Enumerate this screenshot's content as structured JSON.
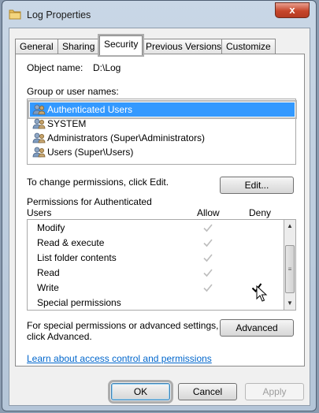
{
  "window": {
    "title": "Log Properties",
    "close_label": "x"
  },
  "tabs": [
    {
      "label": "General"
    },
    {
      "label": "Sharing"
    },
    {
      "label": "Security"
    },
    {
      "label": "Previous Versions"
    },
    {
      "label": "Customize"
    }
  ],
  "security": {
    "object_name_label": "Object name:",
    "object_name_value": "D:\\Log",
    "groups_label": "Group or user names:",
    "users": [
      {
        "name": "Authenticated Users",
        "selected": true
      },
      {
        "name": "SYSTEM",
        "selected": false
      },
      {
        "name": "Administrators (Super\\Administrators)",
        "selected": false
      },
      {
        "name": "Users (Super\\Users)",
        "selected": false
      }
    ],
    "change_hint": "To change permissions, click Edit.",
    "edit_label": "Edit...",
    "permissions_title_line1": "Permissions for Authenticated",
    "permissions_title_line2": "Users",
    "allow_header": "Allow",
    "deny_header": "Deny",
    "permissions": [
      {
        "name": "Modify",
        "allow": "inherited",
        "deny": "none"
      },
      {
        "name": "Read & execute",
        "allow": "inherited",
        "deny": "none"
      },
      {
        "name": "List folder contents",
        "allow": "inherited",
        "deny": "none"
      },
      {
        "name": "Read",
        "allow": "inherited",
        "deny": "none"
      },
      {
        "name": "Write",
        "allow": "inherited",
        "deny": "checked"
      },
      {
        "name": "Special permissions",
        "allow": "none",
        "deny": "none"
      }
    ],
    "advanced_hint_line1": "For special permissions or advanced settings,",
    "advanced_hint_line2": "click Advanced.",
    "advanced_label": "Advanced",
    "learn_link": "Learn about access control and permissions"
  },
  "footer": {
    "ok_label": "OK",
    "cancel_label": "Cancel",
    "apply_label": "Apply"
  },
  "colors": {
    "selection": "#3399ff",
    "link": "#0066cc",
    "inherited_check": "#bdbdbd",
    "checked": "#000000"
  }
}
